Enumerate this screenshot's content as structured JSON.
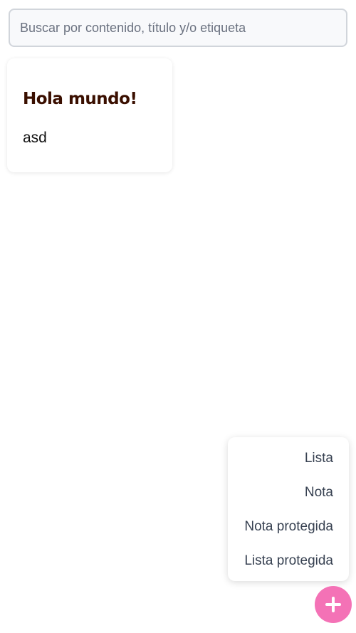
{
  "search": {
    "placeholder": "Buscar por contenido, título y/o etiqueta",
    "value": ""
  },
  "notes": [
    {
      "title": "Hola mundo!",
      "body": "asd"
    }
  ],
  "create_menu": {
    "items": [
      {
        "label": "Lista"
      },
      {
        "label": "Nota"
      },
      {
        "label": "Nota protegida"
      },
      {
        "label": "Lista protegida"
      }
    ]
  },
  "fab": {
    "icon": "plus-icon",
    "color": "#f472b6"
  }
}
